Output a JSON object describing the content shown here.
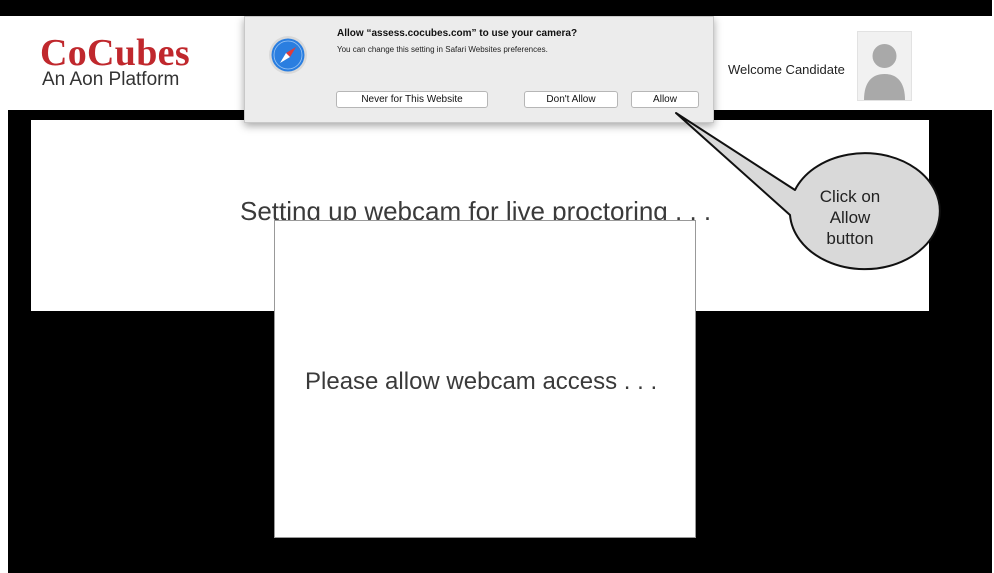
{
  "header": {
    "logo_title": "CoCubes",
    "logo_subtitle": "An Aon Platform",
    "welcome_text": "Welcome Candidate"
  },
  "main": {
    "setup_message": "Setting up webcam for live proctoring . . .",
    "webcam_message": "Please allow webcam access . . ."
  },
  "permission_dialog": {
    "title": "Allow “assess.cocubes.com” to use your camera?",
    "subtitle": "You can change this setting in Safari Websites preferences.",
    "buttons": {
      "never": "Never for This Website",
      "dont_allow": "Don't Allow",
      "allow": "Allow"
    },
    "icon": "safari-compass-icon"
  },
  "callout": {
    "line1": "Click on",
    "line2": "Allow",
    "line3": "button"
  },
  "colors": {
    "brand_red": "#c0282d",
    "stage_black": "#000000",
    "dialog_bg": "#ececec",
    "safari_blue": "#2a7ee0"
  }
}
